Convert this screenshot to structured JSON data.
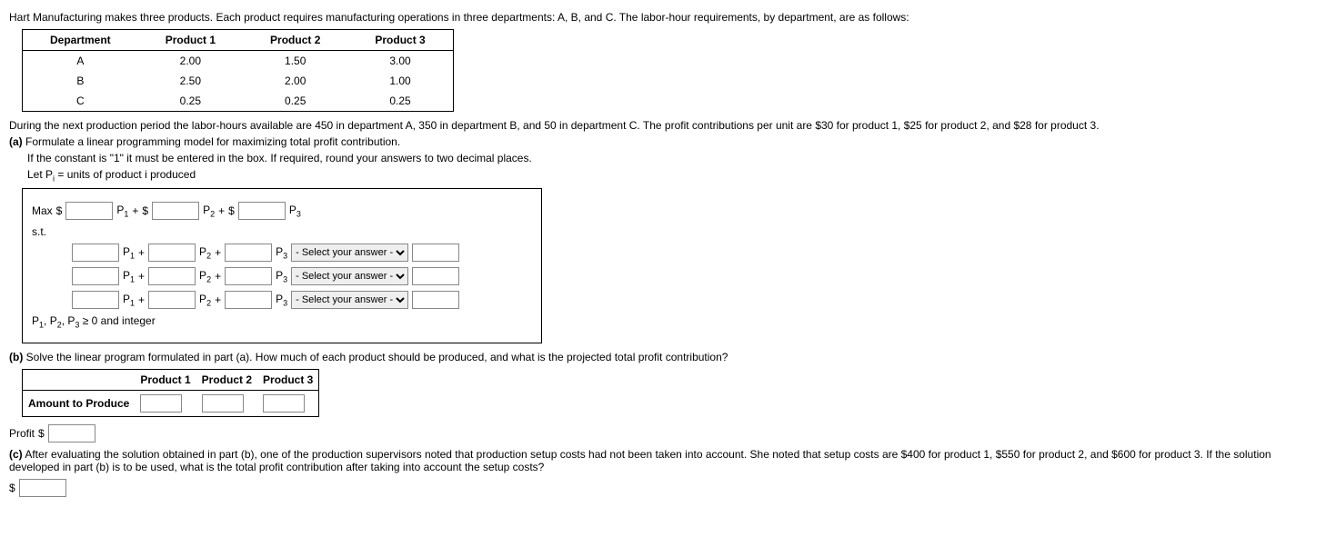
{
  "intro": "Hart Manufacturing makes three products. Each product requires manufacturing operations in three departments: A, B, and C. The labor-hour requirements, by department, are as follows:",
  "table1": {
    "headers": [
      "Department",
      "Product 1",
      "Product 2",
      "Product 3"
    ],
    "rows": [
      [
        "A",
        "2.00",
        "1.50",
        "3.00"
      ],
      [
        "B",
        "2.50",
        "2.00",
        "1.00"
      ],
      [
        "C",
        "0.25",
        "0.25",
        "0.25"
      ]
    ]
  },
  "after_table": "During the next production period the labor-hours available are 450 in department A, 350 in department B, and 50 in department C. The profit contributions per unit are $30 for product 1, $25 for product 2, and $28 for product 3.",
  "part_a": {
    "label": "(a)",
    "text": "Formulate a linear programming model for maximizing total profit contribution.",
    "hint": "If the constant is \"1\" it must be entered in the box. If required, round your answers to two decimal places.",
    "let": "Let Pi = units of product i produced",
    "max_label": "Max",
    "dollar": "$",
    "plus": "+",
    "p1": "P1",
    "p2": "P2",
    "p3": "P3",
    "st": "s.t.",
    "select_placeholder": "- Select your answer -",
    "nonneg": "P1, P2, P3 ≥ 0 and integer"
  },
  "part_b": {
    "label": "(b)",
    "text": "Solve the linear program formulated in part (a). How much of each product should be produced, and what is the projected total profit contribution?",
    "headers": [
      "",
      "Product 1",
      "Product 2",
      "Product 3"
    ],
    "row_label": "Amount to Produce",
    "profit_label": "Profit",
    "dollar": "$"
  },
  "part_c": {
    "label": "(c)",
    "text": "After evaluating the solution obtained in part (b), one of the production supervisors noted that production setup costs had not been taken into account. She noted that setup costs are $400 for product 1, $550 for product 2, and $600 for product 3. If the solution developed in part (b) is to be used, what is the total profit contribution after taking into account the setup costs?",
    "dollar": "$"
  }
}
